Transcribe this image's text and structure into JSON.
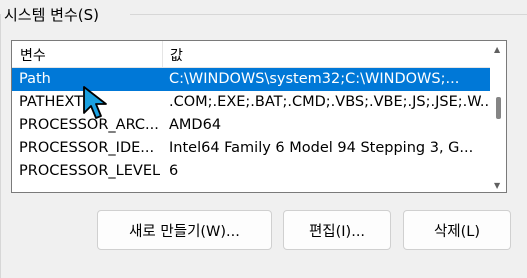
{
  "group_title": "시스템 변수(S)",
  "table": {
    "headers": {
      "variable": "변수",
      "value": "값"
    },
    "rows": [
      {
        "variable": "Path",
        "value": "C:\\WINDOWS\\system32;C:\\WINDOWS;...",
        "selected": true
      },
      {
        "variable": "PATHEXT",
        "value": ".COM;.EXE;.BAT;.CMD;.VBS;.VBE;.JS;.JSE;.W..."
      },
      {
        "variable": "PROCESSOR_ARC...",
        "value": "AMD64"
      },
      {
        "variable": "PROCESSOR_IDE...",
        "value": "Intel64 Family 6 Model 94 Stepping 3, G..."
      },
      {
        "variable": "PROCESSOR_LEVEL",
        "value": "6"
      }
    ]
  },
  "buttons": {
    "new_label": "새로 만들기(W)...",
    "edit_label": "편집(I)...",
    "delete_label": "삭제(L)"
  },
  "colors": {
    "selection": "#0078d7",
    "background": "#f0f0f0"
  }
}
